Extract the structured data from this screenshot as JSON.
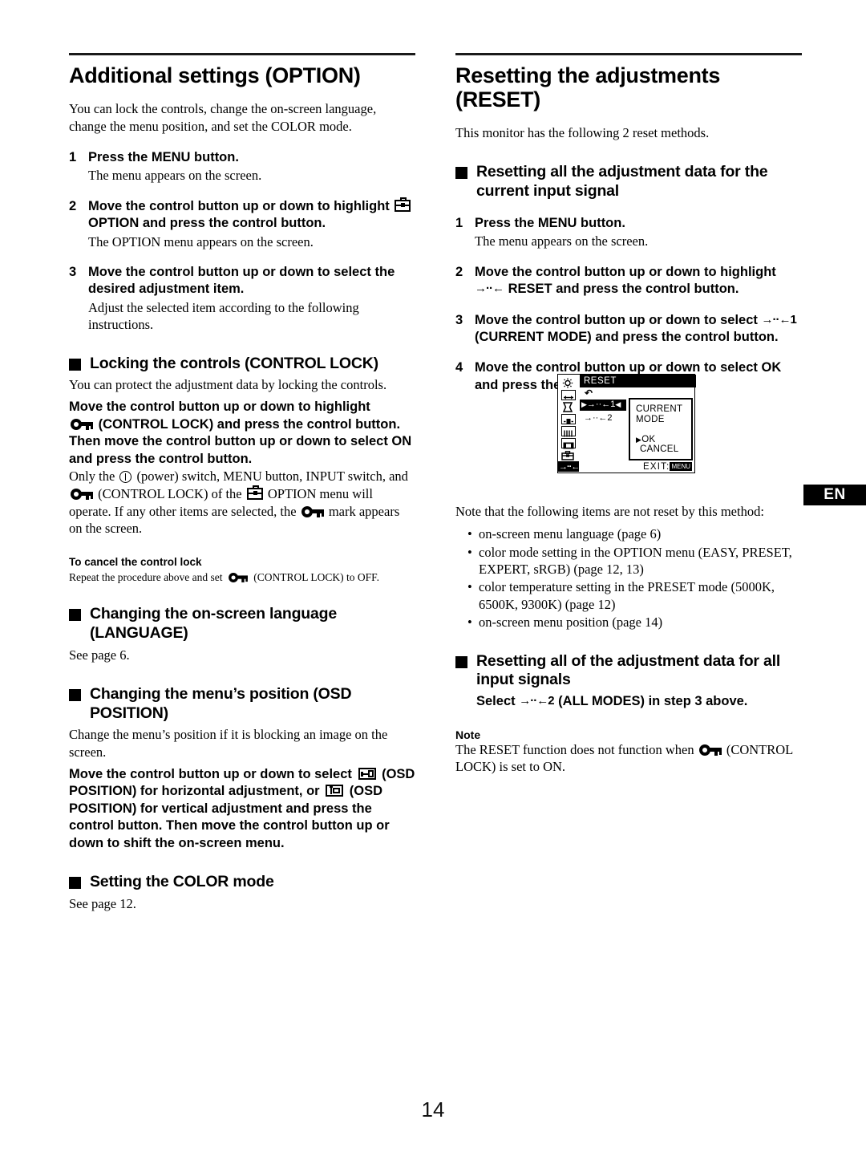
{
  "page_number": "14",
  "language_tab": "EN",
  "left_column": {
    "chapter_title": "Additional settings (OPTION)",
    "intro": "You can lock the controls, change the on-screen language, change the menu position, and set the COLOR mode.",
    "steps": [
      {
        "num": "1",
        "title": "Press the MENU button.",
        "desc": "The menu appears on the screen."
      },
      {
        "num": "2",
        "title_pre": "Move the control button up or down to highlight",
        "title_post": "OPTION and press the control button.",
        "icon": "toolbox-icon",
        "desc": "The OPTION menu appears on the screen."
      },
      {
        "num": "3",
        "title": "Move the control button up or down to select the desired adjustment item.",
        "desc": "Adjust the selected item according to the following instructions."
      }
    ],
    "control_lock": {
      "heading": "Locking the controls (CONTROL LOCK)",
      "para1": "You can protect the adjustment data by locking the controls.",
      "instr_line1": "Move the control button up or down to highlight",
      "instr_line2": "(CONTROL LOCK) and press the control button. Then move the control button up or down to select ON and press the control button.",
      "detail_a": "Only the",
      "detail_b": "(power) switch, MENU button, INPUT switch, and",
      "detail_c": "(CONTROL LOCK) of the",
      "detail_d": "OPTION menu will operate. If any other items are selected, the",
      "detail_e": "mark appears on the screen.",
      "cancel_heading": "To cancel the control lock",
      "cancel_a": "Repeat the procedure above and set",
      "cancel_b": "(CONTROL LOCK) to OFF."
    },
    "language": {
      "heading": "Changing the on-screen language (LANGUAGE)",
      "body": "See page 6."
    },
    "osd_position": {
      "heading": "Changing the menu’s position (OSD POSITION)",
      "body": "Change the menu’s position if it is blocking an image on the screen.",
      "instr_a": "Move the control button up or down to select",
      "instr_b": "(OSD POSITION) for horizontal adjustment, or",
      "instr_c": "(OSD POSITION) for vertical adjustment and press the control button. Then move the control button up or down to shift the on-screen menu."
    },
    "color_mode": {
      "heading": "Setting the COLOR mode",
      "body": "See page 12."
    }
  },
  "right_column": {
    "chapter_title": "Resetting the adjustments (RESET)",
    "intro": "This monitor has the following 2 reset methods.",
    "section1": {
      "heading": "Resetting all the adjustment data for the current input signal",
      "steps": [
        {
          "num": "1",
          "title": "Press the MENU button.",
          "desc": "The menu appears on the screen."
        },
        {
          "num": "2",
          "title_pre": "Move the control button up or down to highlight",
          "reset_icon": "→··←",
          "title_post": "RESET and press the control button."
        },
        {
          "num": "3",
          "title_pre": "Move the control button up or down to select",
          "reset_icon": "→··←1",
          "title_post": "(CURRENT MODE) and press the control button."
        },
        {
          "num": "4",
          "title": "Move the control button up or down to select OK and press the control button."
        }
      ],
      "note_intro": "Note that the following items are not reset by this method:",
      "note_items": [
        "on-screen menu language (page 6)",
        "color mode setting in the OPTION menu (EASY, PRESET, EXPERT, sRGB) (page 12, 13)",
        "color temperature setting in the PRESET mode (5000K, 6500K, 9300K) (page 12)",
        "on-screen menu position (page 14)"
      ]
    },
    "section2": {
      "heading": "Resetting all of the adjustment data for all input signals",
      "instr_pre": "Select",
      "reset_icon": "→··←2",
      "instr_post": "(ALL MODES) in step 3 above.",
      "note_label": "Note",
      "note_a": "The RESET function does not function when",
      "note_b": "(CONTROL LOCK) is set to ON."
    }
  },
  "osd_diagram": {
    "title": "RESET",
    "return_glyph": "↶",
    "row1": "→··←1",
    "row2": "→··←2",
    "panel_title_line1": "CURRENT",
    "panel_title_line2": "MODE",
    "ok_label": "OK",
    "cancel_label": "CANCEL",
    "exit_label": "EXIT:",
    "exit_badge": "MENU",
    "sidebar_icons": [
      "brightness-icon",
      "size-icon",
      "pincushion-icon",
      "rotation-icon",
      "moire-icon",
      "zoom-icon",
      "option-toolbox-icon",
      "reset-icon"
    ]
  }
}
